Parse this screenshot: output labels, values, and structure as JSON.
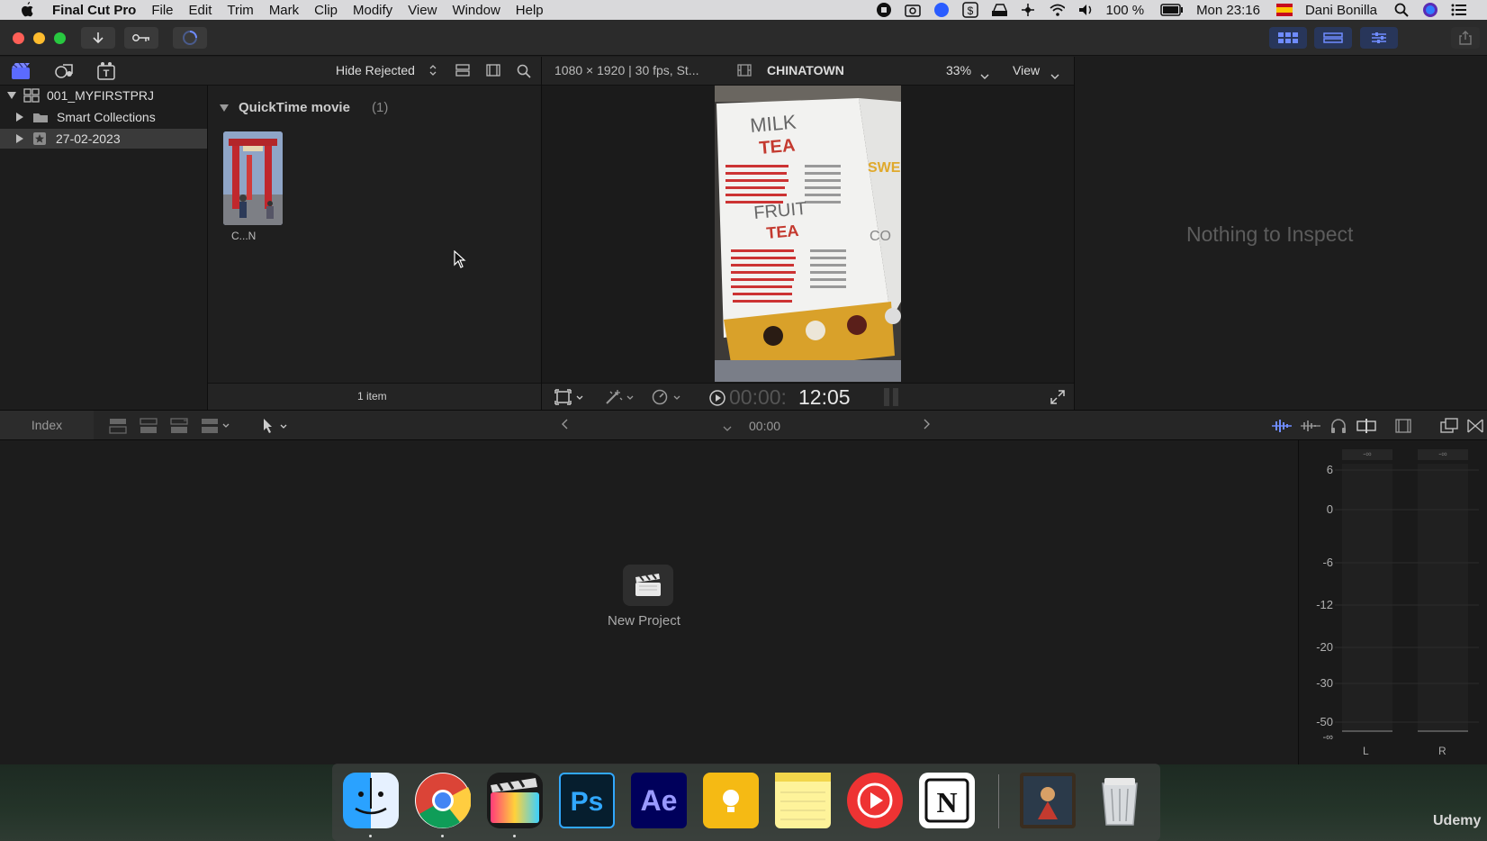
{
  "menubar": {
    "app_name": "Final Cut Pro",
    "menus": [
      "File",
      "Edit",
      "Trim",
      "Mark",
      "Clip",
      "Modify",
      "View",
      "Window",
      "Help"
    ],
    "battery": "100 %",
    "clock": "Mon 23:16",
    "user": "Dani Bonilla"
  },
  "browser": {
    "filter_label": "Hide Rejected",
    "library_name": "001_MYFIRSTPRJ",
    "items": [
      "Smart Collections",
      "27-02-2023"
    ],
    "group_title": "QuickTime movie",
    "group_count": "(1)",
    "clip_label": "C...N",
    "item_count": "1 item"
  },
  "viewer": {
    "format": "1080 × 1920 | 30 fps, St...",
    "clip_name": "CHINATOWN",
    "zoom": "33%",
    "view_label": "View",
    "timecode_dim": "00:00:",
    "timecode": "12:05"
  },
  "inspector": {
    "empty_text": "Nothing to Inspect"
  },
  "timeline": {
    "index_label": "Index",
    "timecode": "00:00",
    "new_project_label": "New Project"
  },
  "meters": {
    "scale": [
      "6",
      "0",
      "-6",
      "-12",
      "-20",
      "-30",
      "-50",
      "-∞"
    ],
    "peak_left": "-∞",
    "peak_right": "-∞",
    "channel_left": "L",
    "channel_right": "R"
  },
  "watermark": "Udemy"
}
